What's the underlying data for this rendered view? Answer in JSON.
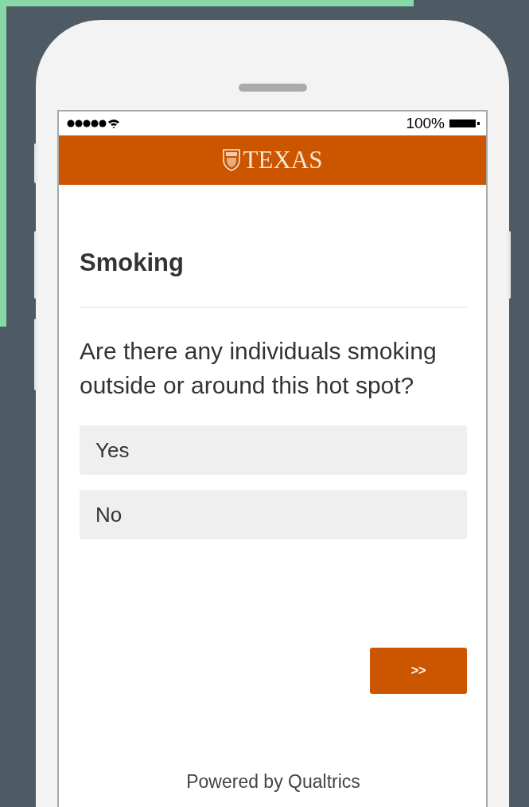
{
  "status_bar": {
    "battery_text": "100%"
  },
  "header": {
    "logo_text": "TEXAS"
  },
  "question_block": {
    "title": "Smoking",
    "question": "Are there any individuals smoking outside or around this hot spot?",
    "choices": [
      {
        "label": "Yes",
        "selected": false
      },
      {
        "label": "No",
        "selected": false
      }
    ]
  },
  "next_button": {
    "label": ">>"
  },
  "footer": {
    "text": "Powered by Qualtrics"
  }
}
